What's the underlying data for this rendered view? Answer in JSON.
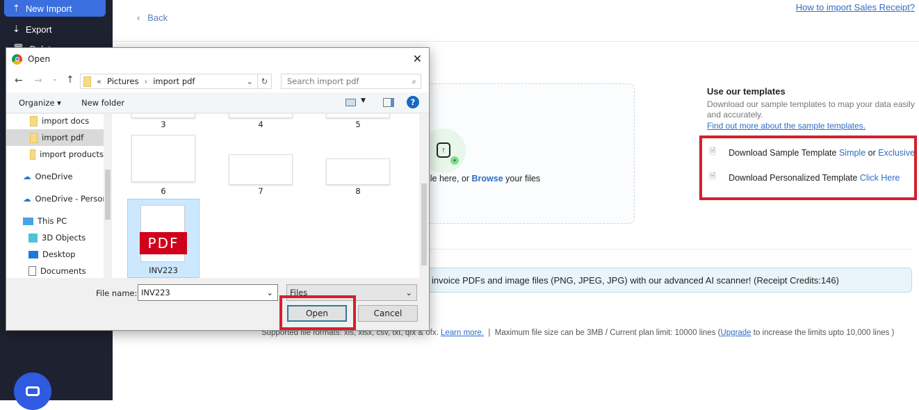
{
  "sidebar": {
    "items": [
      {
        "label": "New Import",
        "icon": "cloud-upload-icon",
        "active": true
      },
      {
        "label": "Export",
        "icon": "cloud-download-icon"
      },
      {
        "label": "Delete",
        "icon": "trash-icon"
      }
    ],
    "chat_icon": "chat-icon"
  },
  "header": {
    "back_label": "Back",
    "help_link": "How to import Sales Receipt?"
  },
  "dropzone": {
    "text_prefix": "ile here, or ",
    "browse": "Browse",
    "text_suffix": " your files"
  },
  "banner": {
    "text": "invoice PDFs and image files (PNG, JPEG, JPG) with our advanced AI scanner! (Receipt Credits:146)"
  },
  "footer": {
    "formats": "Supported file formats: xls, xlsx, csv, txt, qfx & ofx. ",
    "learn_more": "Learn more.",
    "sep": "  |  ",
    "limits": "Maximum file size can be 3MB / Current plan limit: 10000 lines (",
    "upgrade": "Upgrade",
    "limits_end": " to increase the limits upto 10,000 lines )"
  },
  "templates": {
    "title": "Use our templates",
    "description": "Download our sample templates to map your data easily and accurately.",
    "link": "Find out more about the sample templates.",
    "row1": {
      "text": "Download Sample Template ",
      "simple": "Simple",
      "or": " or ",
      "exclusive": "Exclusive"
    },
    "row2": {
      "text": "Download Personalized Template ",
      "click": "Click Here"
    }
  },
  "dialog": {
    "title": "Open",
    "path": [
      "Pictures",
      "import pdf"
    ],
    "path_prefix": "«",
    "search_placeholder": "Search import pdf",
    "organize": "Organize",
    "new_folder": "New folder",
    "tree": [
      {
        "label": "import docs",
        "type": "folder"
      },
      {
        "label": "import pdf",
        "type": "folder",
        "selected": true
      },
      {
        "label": "import products",
        "type": "folder"
      },
      {
        "label": "OneDrive",
        "type": "cloud"
      },
      {
        "label": "OneDrive - Persor",
        "type": "cloud"
      },
      {
        "label": "This PC",
        "type": "pc"
      },
      {
        "label": "3D Objects",
        "type": "cube"
      },
      {
        "label": "Desktop",
        "type": "desktop"
      },
      {
        "label": "Documents",
        "type": "docs"
      }
    ],
    "files": [
      {
        "label": "3"
      },
      {
        "label": "4"
      },
      {
        "label": "5"
      },
      {
        "label": "6"
      },
      {
        "label": "7"
      },
      {
        "label": "8"
      },
      {
        "label": "INV223",
        "pdf": "PDF",
        "selected": true
      }
    ],
    "file_name_label": "File name:",
    "file_name_value": "INV223",
    "file_type": "Files",
    "open": "Open",
    "cancel": "Cancel"
  },
  "colors": {
    "accent": "#3b6fe0",
    "highlight": "#d4202a",
    "sidebar": "#1e2230"
  }
}
